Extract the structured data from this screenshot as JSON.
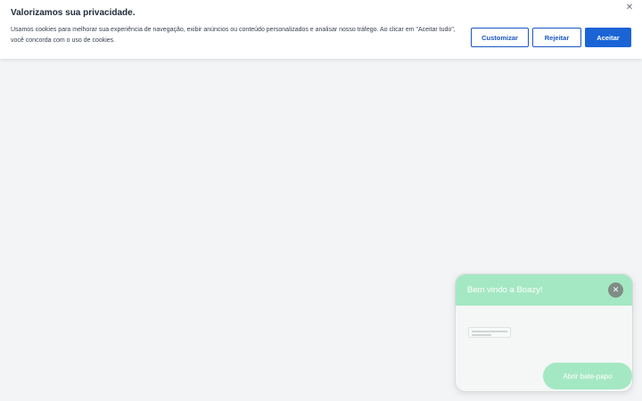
{
  "cookie_banner": {
    "title": "Valorizamos sua privacidade.",
    "text": "Usamos cookies para melhorar sua experiência de navegação, exibir anúncios ou conteúdo personalizados e analisar nosso tráfego. Ao clicar em \"Aceitar tudo\", você concorda com o uso de cookies.",
    "close_icon": "close-icon",
    "buttons": {
      "customize": "Customizar",
      "reject": "Rejeitar",
      "accept": "Aceitar"
    },
    "accent_color": "#1a64d6"
  },
  "chat_widget": {
    "title": "Bem vindo a Boazy!",
    "close_icon": "close-icon",
    "open_button": "Abrir bate-papo",
    "accent_color": "#a4e8c3"
  }
}
